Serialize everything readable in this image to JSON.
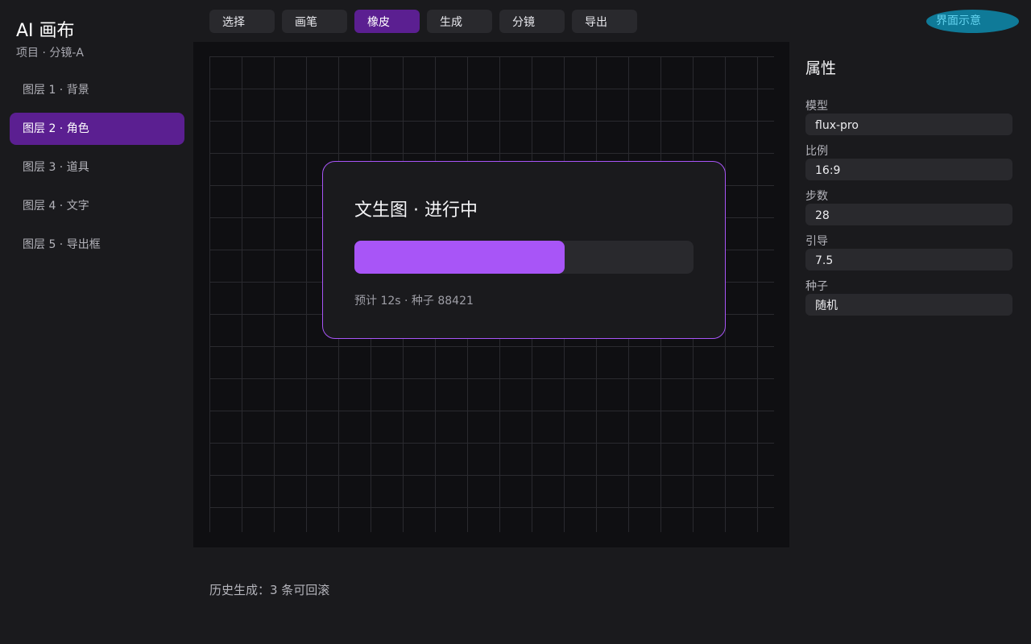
{
  "app": {
    "title": "AI 画布",
    "project": "项目 · 分镜-A"
  },
  "layers": [
    {
      "label": "图层 1 · 背景",
      "active": false
    },
    {
      "label": "图层 2 · 角色",
      "active": true
    },
    {
      "label": "图层 3 · 道具",
      "active": false
    },
    {
      "label": "图层 4 · 文字",
      "active": false
    },
    {
      "label": "图层 5 · 导出框",
      "active": false
    }
  ],
  "toolbar": {
    "buttons": [
      {
        "label": "选择",
        "active": false
      },
      {
        "label": "画笔",
        "active": false
      },
      {
        "label": "橡皮",
        "active": true
      },
      {
        "label": "生成",
        "active": false
      },
      {
        "label": "分镜",
        "active": false
      },
      {
        "label": "导出",
        "active": false
      }
    ]
  },
  "badge": "界面示意",
  "generation": {
    "title": "文生图 · 进行中",
    "progress": 0.62,
    "meta": "预计 12s · 种子 88421"
  },
  "properties": {
    "title": "属性",
    "fields": [
      {
        "label": "模型",
        "value": "flux-pro"
      },
      {
        "label": "比例",
        "value": "16:9"
      },
      {
        "label": "步数",
        "value": "28"
      },
      {
        "label": "引导",
        "value": "7.5"
      },
      {
        "label": "种子",
        "value": "随机"
      }
    ]
  },
  "history": "历史生成：3 条可回滚",
  "colors": {
    "accent": "#a855f7",
    "accent_dark": "#5b1f91",
    "badge": "#0f7a98"
  }
}
